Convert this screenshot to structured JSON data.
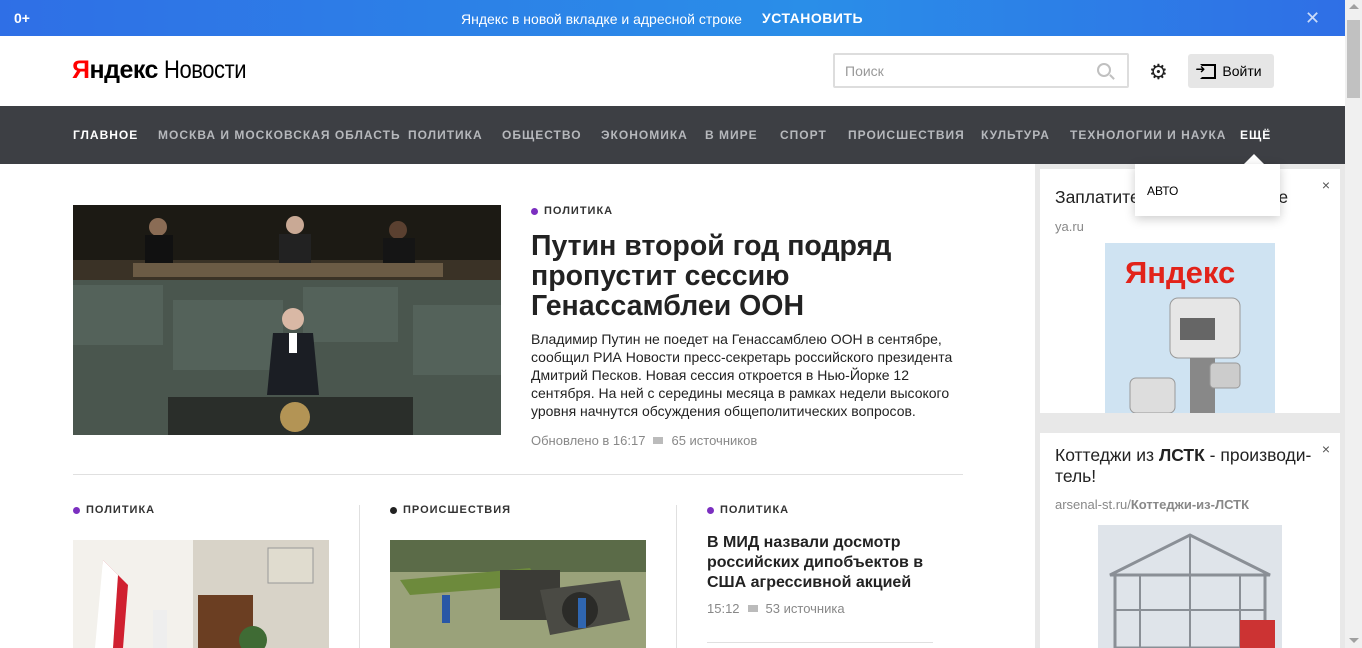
{
  "promo": {
    "age_label": "0+",
    "text": "Яндекс в новой вкладке и адресной строке",
    "install_label": "УСТАНОВИТЬ",
    "close_glyph": "✕"
  },
  "header": {
    "logo_ya": "Я",
    "logo_ndex": "ндекс",
    "logo_news": "Новости",
    "search_placeholder": "Поиск",
    "login_label": "Войти"
  },
  "nav": {
    "items": [
      "ГЛАВНОЕ",
      "МОСКВА И МОСКОВСКАЯ ОБЛАСТЬ",
      "ПОЛИТИКА",
      "ОБЩЕСТВО",
      "ЭКОНОМИКА",
      "В МИРЕ",
      "СПОРТ",
      "ПРОИСШЕСТВИЯ",
      "КУЛЬТУРА",
      "ТЕХНОЛОГИИ И НАУКА",
      "ЕЩЁ"
    ],
    "active_index": 0,
    "dropdown_items": [
      "АВТО"
    ]
  },
  "main_story": {
    "rubric": "ПОЛИТИКА",
    "title": "Путин второй год подряд пропустит сессию Генассамблеи ООН",
    "lead": "Владимир Путин не поедет на Генассамблею ООН в сентябре, сообщил РИА Новости пресс-секретарь российского президента Дмитрий Песков. Новая сессия откроется в Нью-Йорке 12 сентября. На ней с середины месяца в рамках недели высокого уровня начнутся обсуждения общеполитических вопросов.",
    "updated": "Обновлено в 16:17",
    "sources": "65 источников"
  },
  "stories": [
    {
      "rubric": "ПОЛИТИКА"
    },
    {
      "rubric": "ПРОИСШЕСТВИЯ"
    },
    {
      "rubric": "ПОЛИТИКА",
      "title": "В МИД назвали досмотр российских дипобъектов в США агрессивной акцией",
      "time": "15:12",
      "sources": "53 источника"
    }
  ],
  "ads": [
    {
      "title": "Заплатите штраф в Яндексе",
      "domain": "ya.ru",
      "close_glyph": "×"
    },
    {
      "title_pre": "Коттеджи из ",
      "title_bold": "ЛСТК",
      "title_post": " - производи-тель!",
      "domain": "arsenal-st.ru/",
      "domain_path": "Коттеджи-из-ЛСТК",
      "close_glyph": "×"
    }
  ],
  "ad_image_text": "Яндекс",
  "colors": {
    "politics": "#7b2fc0",
    "incidents": "#222222",
    "nav_bg": "#3d3f44"
  }
}
